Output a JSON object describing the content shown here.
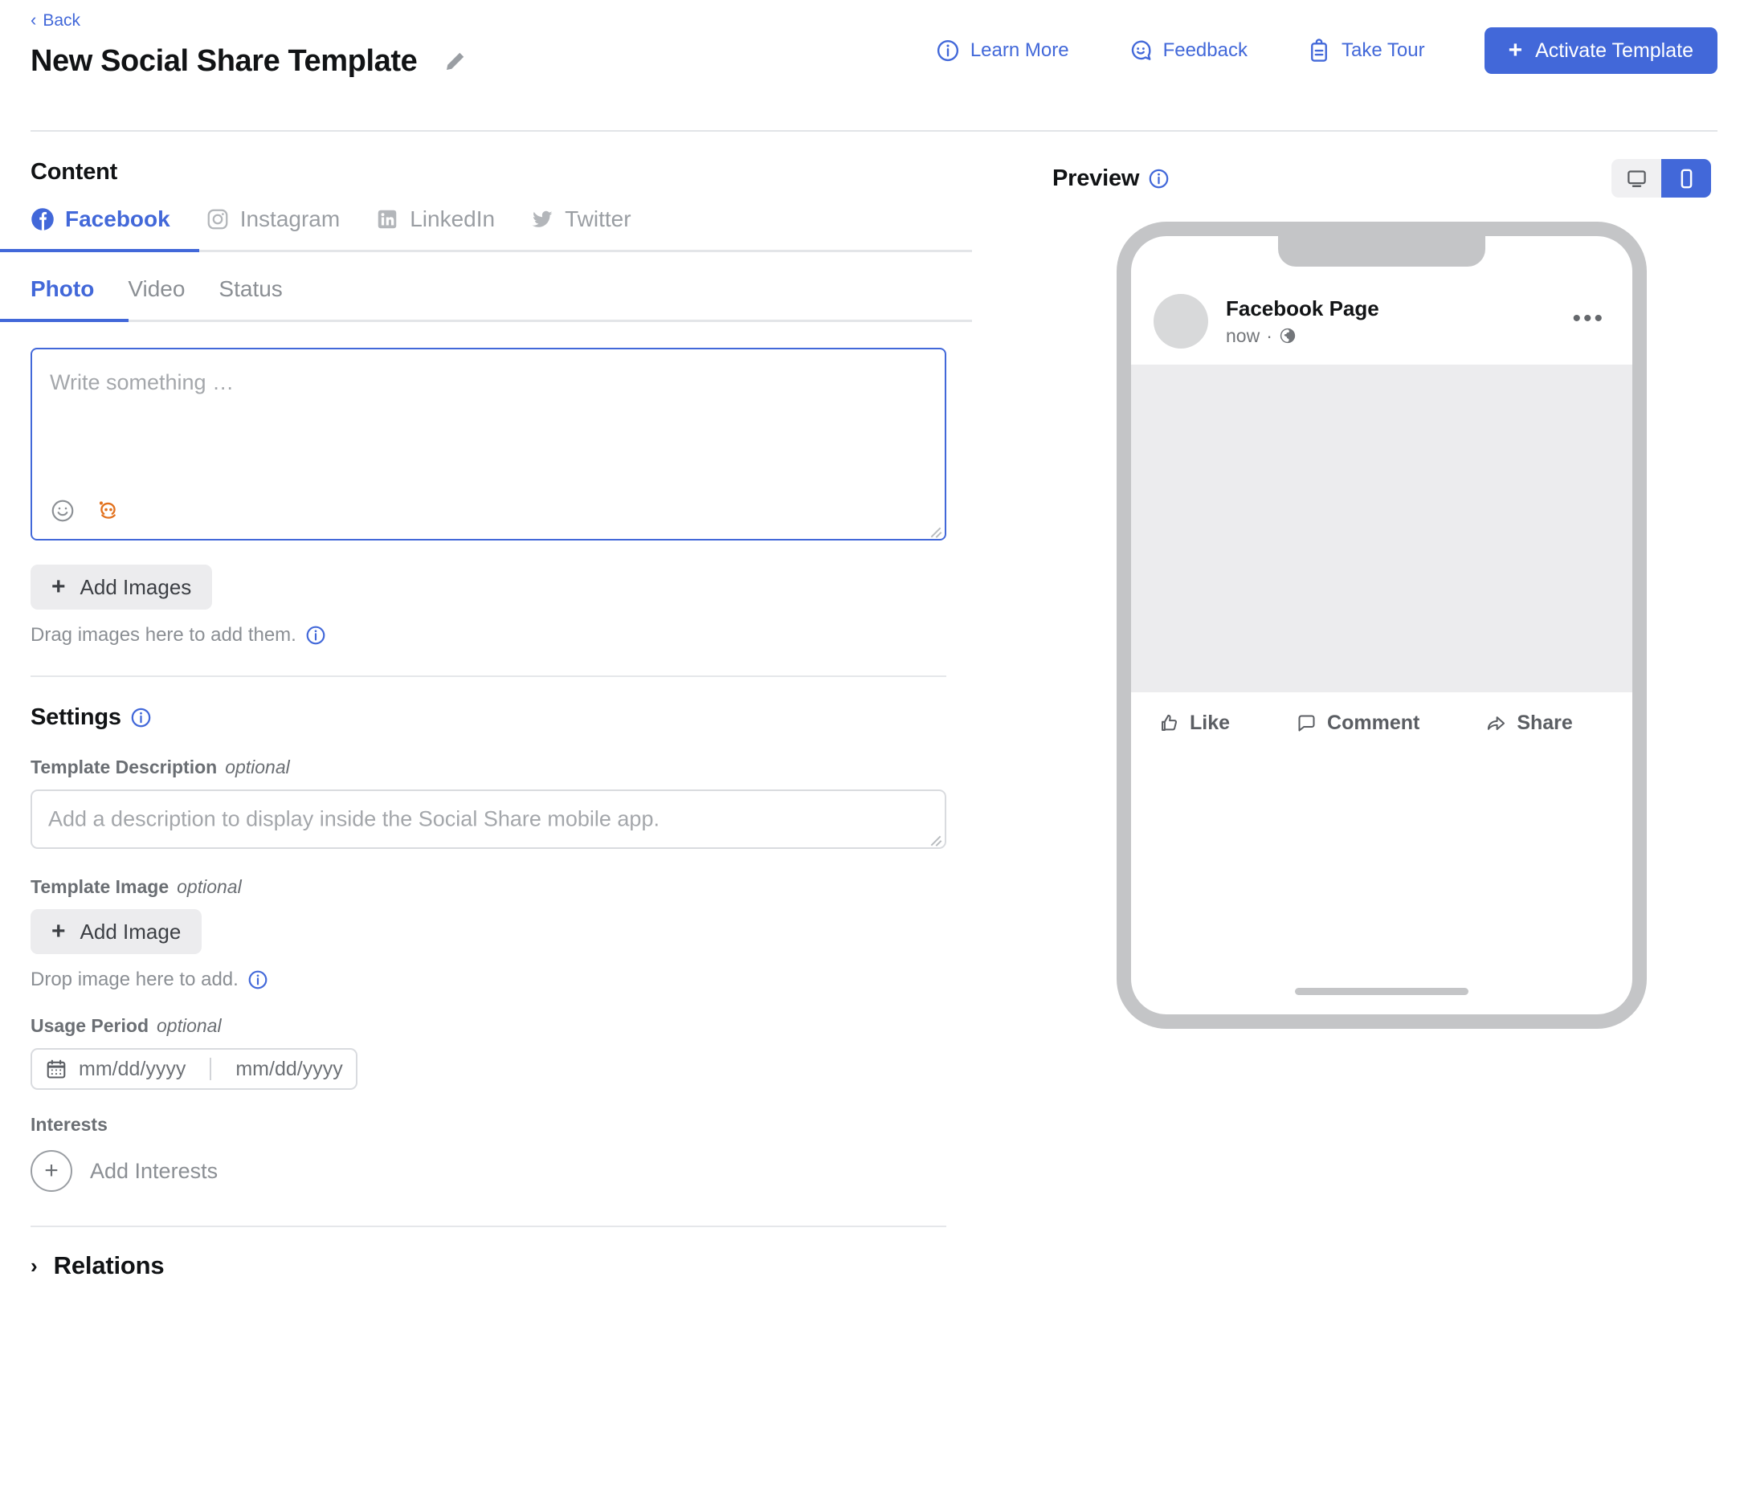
{
  "header": {
    "back_label": "Back",
    "title": "New Social Share Template",
    "edit_icon": "pencil-icon",
    "actions": [
      {
        "label": "Learn More",
        "icon": "info-circle-icon"
      },
      {
        "label": "Feedback",
        "icon": "feedback-smiley-icon"
      },
      {
        "label": "Take Tour",
        "icon": "clipboard-icon"
      }
    ],
    "activate": {
      "label": "Activate Template",
      "plus": "+"
    }
  },
  "content": {
    "heading": "Content",
    "platform_tabs": [
      {
        "label": "Facebook",
        "icon": "facebook-icon",
        "active": true
      },
      {
        "label": "Instagram",
        "icon": "instagram-icon",
        "active": false
      },
      {
        "label": "LinkedIn",
        "icon": "linkedin-icon",
        "active": false
      },
      {
        "label": "Twitter",
        "icon": "twitter-icon",
        "active": false
      }
    ],
    "type_tabs": [
      {
        "label": "Photo",
        "active": true
      },
      {
        "label": "Video",
        "active": false
      },
      {
        "label": "Status",
        "active": false
      }
    ],
    "composer": {
      "placeholder": "Write something …",
      "value": "",
      "tools": [
        {
          "icon": "emoji-smiley-icon"
        },
        {
          "icon": "bot-assistant-icon"
        }
      ]
    },
    "add_images": {
      "label": "Add Images",
      "plus": "+"
    },
    "images_hint": "Drag images here to add them."
  },
  "settings": {
    "heading": "Settings",
    "template_description": {
      "label": "Template Description",
      "optional": "optional",
      "placeholder": "Add a description to display inside the Social Share mobile app.",
      "value": ""
    },
    "template_image": {
      "label": "Template Image",
      "optional": "optional",
      "button": "Add Image",
      "plus": "+",
      "hint": "Drop image here to add."
    },
    "usage_period": {
      "label": "Usage Period",
      "optional": "optional",
      "start_placeholder": "mm/dd/yyyy",
      "end_placeholder": "mm/dd/yyyy",
      "start_value": "",
      "end_value": ""
    },
    "interests": {
      "label": "Interests",
      "add_label": "Add Interests",
      "plus": "+"
    }
  },
  "relations": {
    "label": "Relations",
    "chevron": "›"
  },
  "preview": {
    "heading": "Preview",
    "info_icon": "info-circle-icon",
    "devices": [
      {
        "name": "desktop",
        "icon": "monitor-icon",
        "active": false
      },
      {
        "name": "mobile",
        "icon": "phone-icon",
        "active": true
      }
    ],
    "post": {
      "page_name": "Facebook Page",
      "time": "now",
      "separator": "·",
      "privacy_icon": "globe-icon",
      "more_icon": "ellipsis-icon",
      "actions": [
        {
          "label": "Like",
          "icon": "thumbs-up-icon"
        },
        {
          "label": "Comment",
          "icon": "comment-bubble-icon"
        },
        {
          "label": "Share",
          "icon": "share-arrow-icon"
        }
      ]
    }
  },
  "colors": {
    "accent": "#4268d9",
    "muted_text": "#8b8f94",
    "grey_button": "#ececee",
    "phone_frame": "#c4c5c7",
    "image_placeholder": "#ececee",
    "bot_icon": "#e2711d"
  }
}
